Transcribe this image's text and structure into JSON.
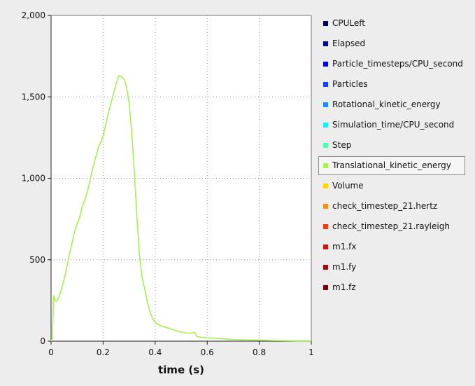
{
  "chart_data": {
    "type": "line",
    "xlabel": "time (s)",
    "ylabel": "",
    "xlim": [
      0,
      1
    ],
    "ylim": [
      0,
      2000
    ],
    "x_ticks": [
      0,
      0.2,
      0.4,
      0.6,
      0.8,
      1
    ],
    "x_tick_labels": [
      "0",
      "0.2",
      "0.4",
      "0.6",
      "0.8",
      "1"
    ],
    "y_ticks": [
      0,
      500,
      1000,
      1500,
      2000
    ],
    "y_tick_labels": [
      "0",
      "500",
      "1,000",
      "1,500",
      "2,000"
    ],
    "grid": true,
    "legend_position": "right",
    "series": [
      {
        "name": "Translational_kinetic_energy",
        "color": "#a6f24f",
        "x": [
          0,
          0.005,
          0.01,
          0.015,
          0.02,
          0.025,
          0.03,
          0.04,
          0.05,
          0.06,
          0.07,
          0.08,
          0.09,
          0.1,
          0.11,
          0.12,
          0.13,
          0.14,
          0.15,
          0.16,
          0.17,
          0.18,
          0.19,
          0.2,
          0.21,
          0.22,
          0.23,
          0.24,
          0.25,
          0.26,
          0.27,
          0.28,
          0.29,
          0.3,
          0.31,
          0.32,
          0.33,
          0.34,
          0.35,
          0.36,
          0.37,
          0.38,
          0.39,
          0.4,
          0.42,
          0.44,
          0.46,
          0.48,
          0.5,
          0.52,
          0.54,
          0.55,
          0.56,
          0.57,
          0.6,
          0.65,
          0.7,
          0.75,
          0.8,
          0.85,
          0.9,
          0.95,
          1.0
        ],
        "values": [
          0,
          20,
          280,
          250,
          245,
          255,
          270,
          320,
          380,
          450,
          530,
          600,
          670,
          720,
          760,
          830,
          870,
          920,
          990,
          1060,
          1120,
          1180,
          1220,
          1260,
          1330,
          1400,
          1460,
          1520,
          1580,
          1630,
          1625,
          1610,
          1560,
          1460,
          1280,
          1040,
          760,
          520,
          390,
          320,
          240,
          180,
          140,
          115,
          95,
          85,
          75,
          65,
          55,
          50,
          50,
          55,
          30,
          25,
          20,
          15,
          10,
          8,
          6,
          4,
          3,
          2,
          2
        ]
      }
    ]
  },
  "legend": {
    "items": [
      {
        "label": "CPULeft",
        "color": "#00005a"
      },
      {
        "label": "Elapsed",
        "color": "#0000a0"
      },
      {
        "label": "Particle_timesteps/CPU_second",
        "color": "#0000e6"
      },
      {
        "label": "Particles",
        "color": "#1a3cff"
      },
      {
        "label": "Rotational_kinetic_energy",
        "color": "#1a8cff"
      },
      {
        "label": "Simulation_time/CPU_second",
        "color": "#14f0ff"
      },
      {
        "label": "Step",
        "color": "#4dfcae"
      },
      {
        "label": "Translational_kinetic_energy",
        "color": "#a6f24f",
        "selected": true
      },
      {
        "label": "Volume",
        "color": "#ffd700"
      },
      {
        "label": "check_timestep_21.hertz",
        "color": "#ff8c1a"
      },
      {
        "label": "check_timestep_21.rayleigh",
        "color": "#f03c14"
      },
      {
        "label": "m1.fx",
        "color": "#d21414"
      },
      {
        "label": "m1.fy",
        "color": "#a00a0a"
      },
      {
        "label": "m1.fz",
        "color": "#780505"
      }
    ]
  }
}
